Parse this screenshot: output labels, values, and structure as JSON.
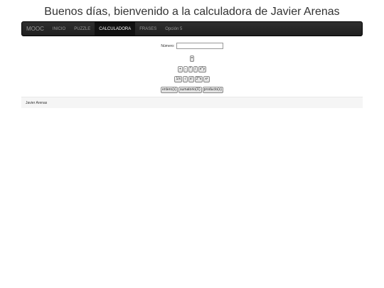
{
  "page": {
    "title": "Buenos días, bienvenido a la calculadora de Javier Arenas"
  },
  "navbar": {
    "brand": "MOOC",
    "items": [
      {
        "label": "INICIO",
        "active": false
      },
      {
        "label": "PUZZLE",
        "active": false
      },
      {
        "label": "CALCULADORA",
        "active": true
      },
      {
        "label": "FRASES",
        "active": false
      },
      {
        "label": "Opción 5",
        "active": false
      }
    ]
  },
  "calculator": {
    "number_label": "Número:",
    "number_value": "",
    "equals_label": "=",
    "ops_row1": [
      "+",
      "-",
      "*",
      "/",
      "x^y"
    ],
    "ops_row2": [
      "1/x",
      "√",
      "x!",
      "2^x",
      "x²"
    ],
    "ops_row3": [
      "entero(x)",
      "sumatorio(X)",
      "producto(x)"
    ]
  },
  "footer": {
    "text": "Javier Arenas"
  }
}
